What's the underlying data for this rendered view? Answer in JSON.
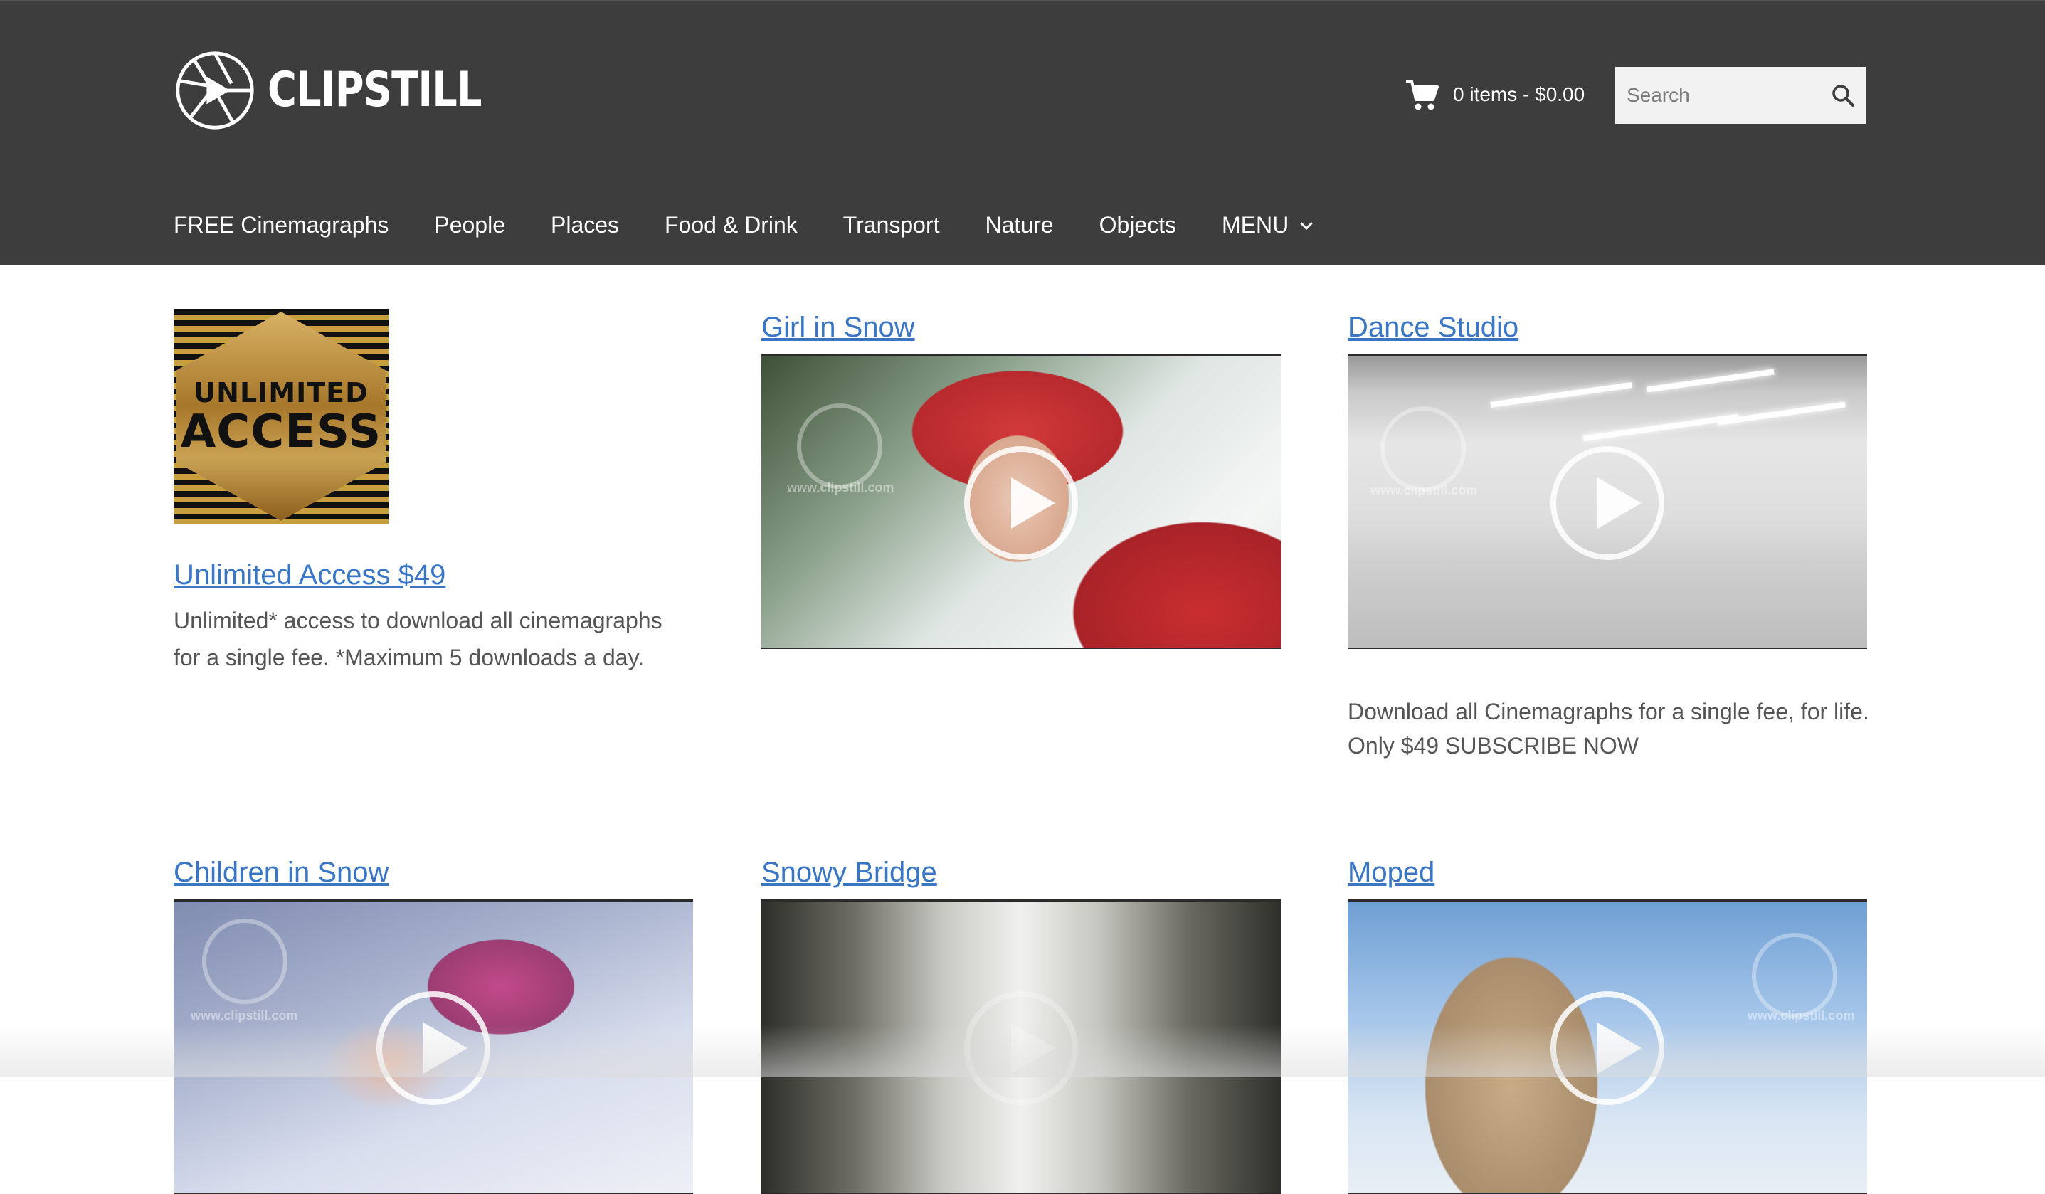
{
  "header": {
    "brand": "CLIPSTILL",
    "cart": {
      "label": "0 items - $0.00",
      "icon": "cart-icon"
    },
    "search": {
      "placeholder": "Search",
      "icon": "search-icon"
    }
  },
  "nav": {
    "items": [
      {
        "label": "FREE Cinemagraphs"
      },
      {
        "label": "People"
      },
      {
        "label": "Places"
      },
      {
        "label": "Food & Drink"
      },
      {
        "label": "Transport"
      },
      {
        "label": "Nature"
      },
      {
        "label": "Objects"
      },
      {
        "label": "MENU",
        "icon": "chevron-down-icon"
      }
    ]
  },
  "cards": {
    "unlimited": {
      "badge_line1": "UNLIMITED",
      "badge_line2": "ACCESS",
      "title": "Unlimited Access $49",
      "description": "Unlimited* access to download all cinemagraphs for a single fee. *Maximum 5 downloads a day."
    },
    "girl_in_snow": {
      "title": "Girl in Snow",
      "watermark": "www.clipstill.com"
    },
    "dance_studio": {
      "title": "Dance Studio",
      "watermark": "www.clipstill.com",
      "description": "Download all Cinemagraphs for a single fee, for life. Only $49 SUBSCRIBE NOW"
    },
    "children_in_snow": {
      "title": "Children in Snow",
      "watermark": "www.clipstill.com"
    },
    "snowy_bridge": {
      "title": "Snowy Bridge"
    },
    "moped": {
      "title": "Moped",
      "watermark": "www.clipstill.com"
    }
  },
  "colors": {
    "header_bg": "#3d3d3d",
    "link": "#3a76c4",
    "body_text": "#555555"
  }
}
